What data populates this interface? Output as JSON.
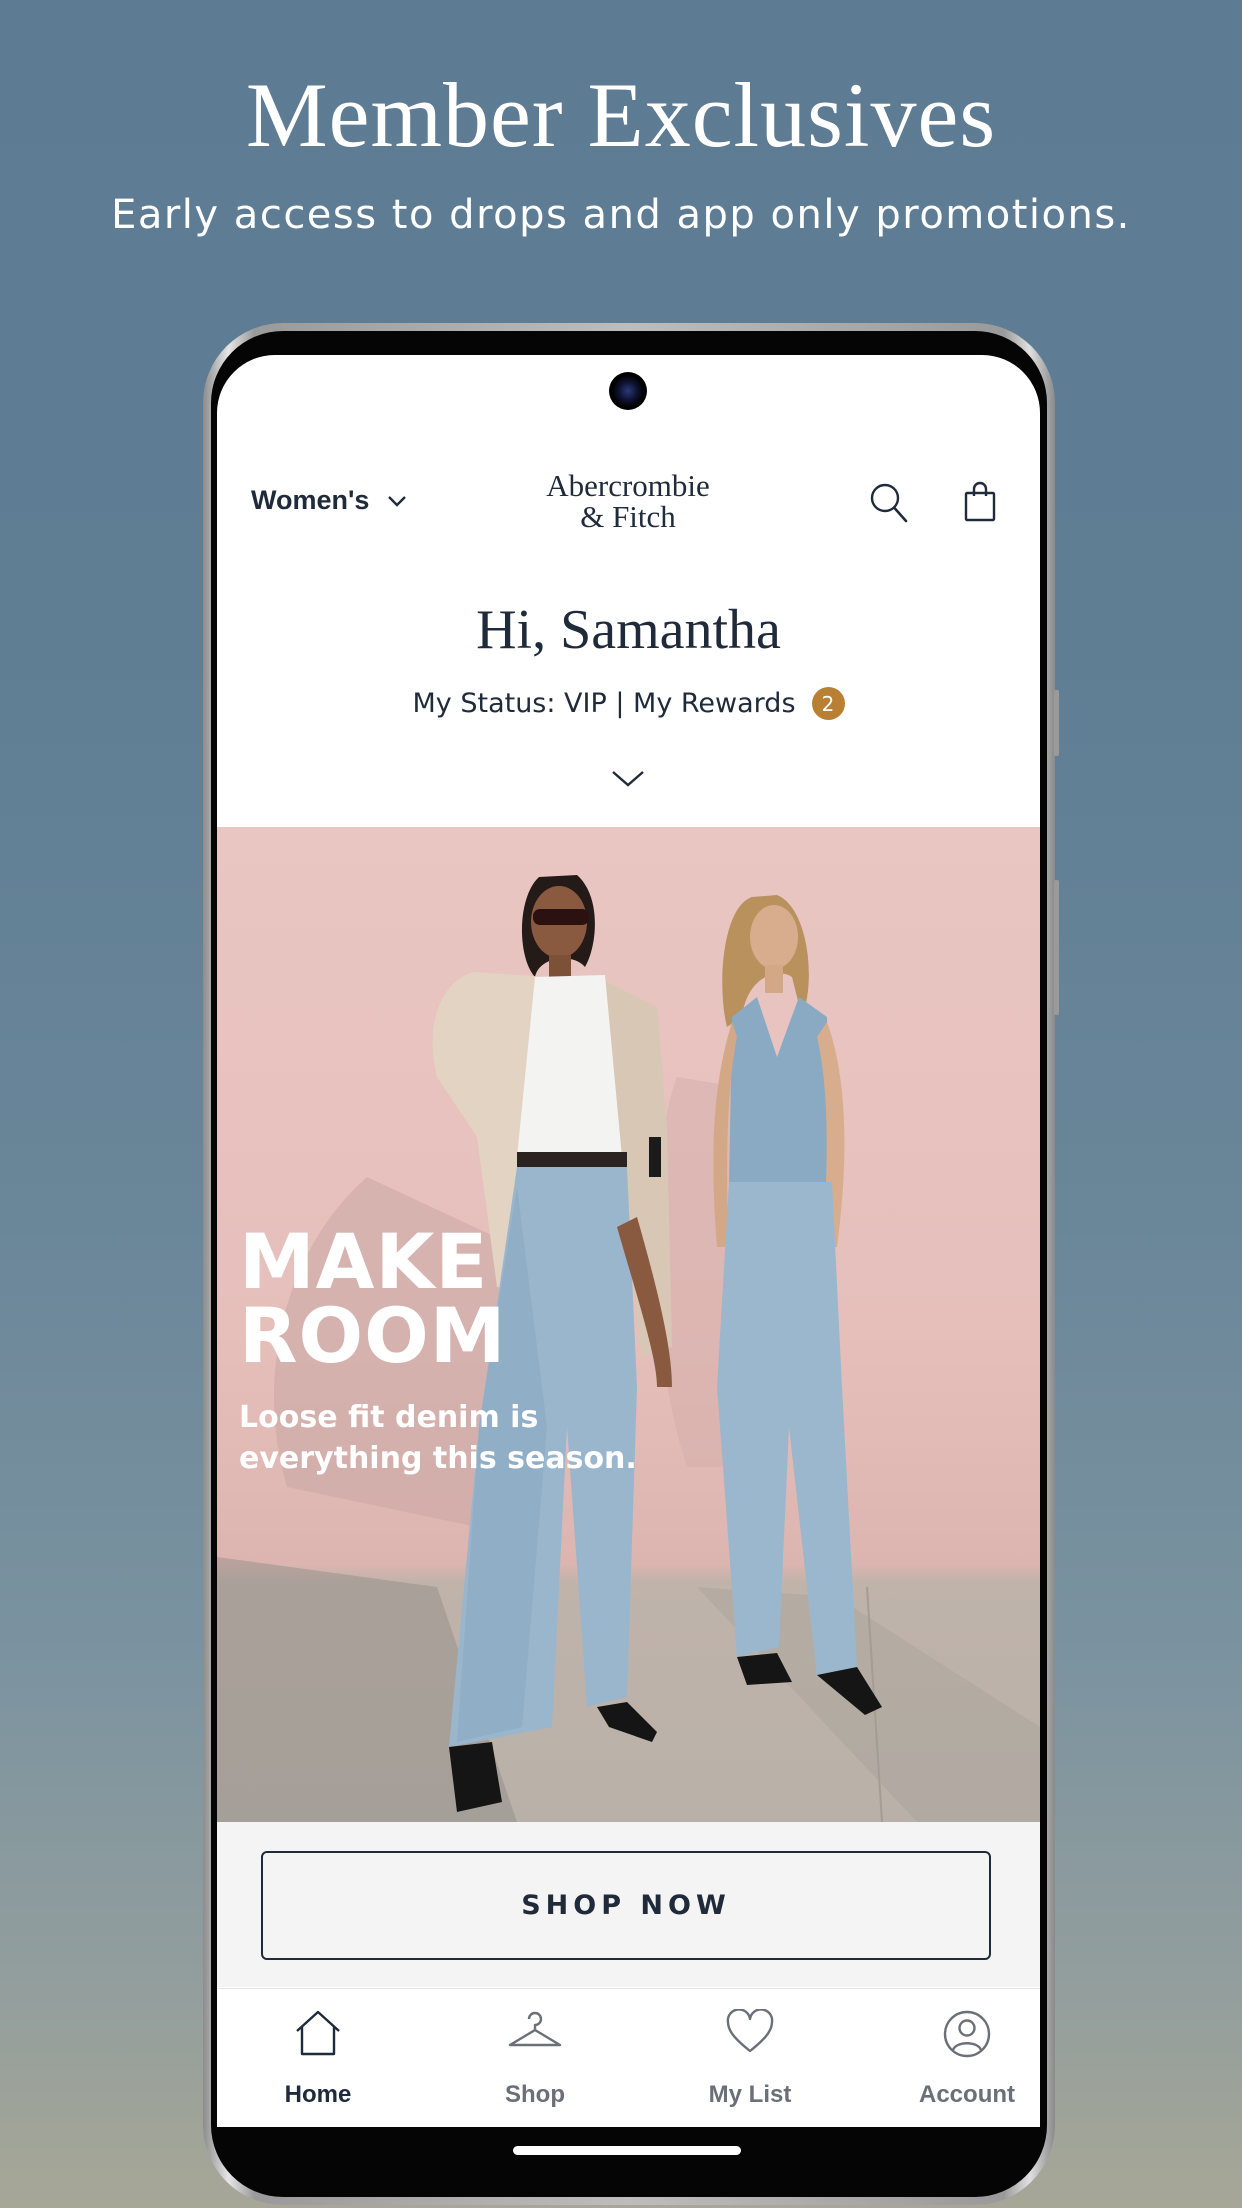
{
  "promo": {
    "title": "Member Exclusives",
    "subtitle": "Early access to drops and app only promotions."
  },
  "header": {
    "department": "Women's",
    "logo_line1": "Abercrombie",
    "logo_line2": "& Fitch",
    "icons": [
      "search-icon",
      "shopping-bag-icon"
    ]
  },
  "welcome": {
    "greeting": "Hi, Samantha",
    "status": "My Status: VIP | My Rewards",
    "rewards_count": "2"
  },
  "hero": {
    "headline": "MAKE\nROOM",
    "subtext": "Loose fit denim is everything this season."
  },
  "cta": {
    "label": "SHOP NOW"
  },
  "tabs": [
    {
      "label": "Home",
      "icon": "home-icon",
      "active": true
    },
    {
      "label": "Shop",
      "icon": "hanger-icon",
      "active": false
    },
    {
      "label": "My List",
      "icon": "heart-icon",
      "active": false
    },
    {
      "label": "Account",
      "icon": "account-icon",
      "active": false
    }
  ],
  "colors": {
    "brand_navy": "#1f2b3a",
    "rewards_badge": "#b98033",
    "hero_background": "#e9c6c2"
  }
}
